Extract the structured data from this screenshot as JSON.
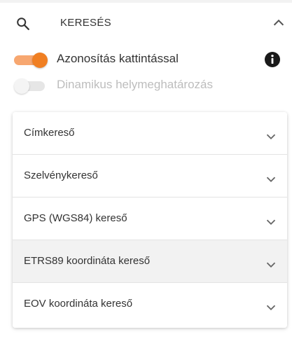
{
  "header": {
    "title": "KERESÉS",
    "search_icon": "search-icon",
    "collapse_icon": "chevron-up-icon"
  },
  "toggles": [
    {
      "label": "Azonosítás kattintással",
      "state": "on",
      "enabled": true
    },
    {
      "label": "Dinamikus helymeghatározás",
      "state": "off",
      "enabled": false
    }
  ],
  "info_icon": "info-icon",
  "accordion": {
    "items": [
      {
        "label": "Címkereső"
      },
      {
        "label": "Szelvénykereső"
      },
      {
        "label": "GPS (WGS84) kereső"
      },
      {
        "label": "ETRS89 koordináta kereső"
      },
      {
        "label": "EOV koordináta kereső"
      }
    ]
  },
  "colors": {
    "accent": "#f07f22",
    "accent_track": "#f7a770",
    "text": "#333333",
    "disabled_text": "#bdbdbd",
    "hover_bg": "#f2f2f2"
  }
}
